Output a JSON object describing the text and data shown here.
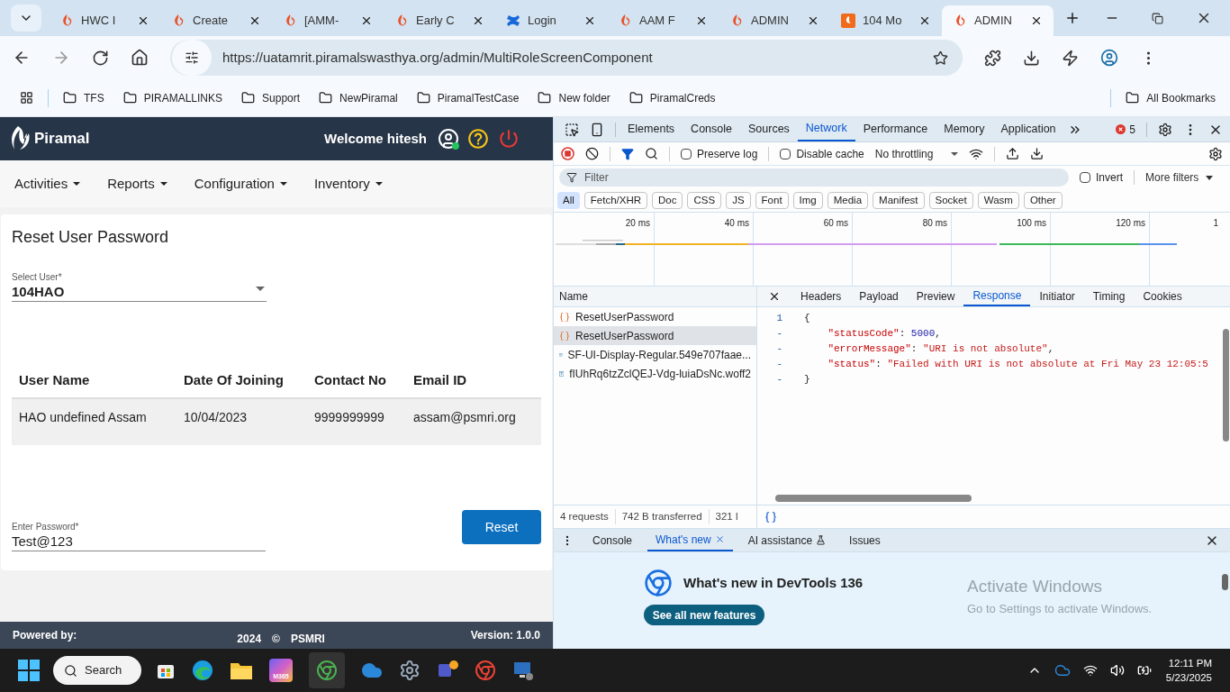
{
  "browser": {
    "tabs": [
      {
        "title": "HWC I",
        "kind": "flame",
        "selected": false
      },
      {
        "title": "Create",
        "kind": "flame",
        "selected": false
      },
      {
        "title": "[AMM-",
        "kind": "flame",
        "selected": false
      },
      {
        "title": "Early C",
        "kind": "flame",
        "selected": false
      },
      {
        "title": "Login",
        "kind": "cross",
        "selected": false
      },
      {
        "title": "AAM F",
        "kind": "flame",
        "selected": false
      },
      {
        "title": "ADMIN",
        "kind": "flame",
        "selected": false
      },
      {
        "title": "104 Mo",
        "kind": "square",
        "selected": false
      },
      {
        "title": "ADMIN",
        "kind": "flame",
        "selected": true
      }
    ],
    "url": "https://uatamrit.piramalswasthya.org/admin/MultiRoleScreenComponent",
    "bookmarks": [
      "TFS",
      "PIRAMALLINKS",
      "Support",
      "NewPiramal",
      "PiramalTestCase",
      "New folder",
      "PiramalCreds"
    ],
    "all_bookmarks": "All Bookmarks"
  },
  "app": {
    "brand": "Piramal",
    "welcome": "Welcome hitesh",
    "user_online": true,
    "menu": [
      "Activities",
      "Reports",
      "Configuration",
      "Inventory"
    ],
    "page_title": "Reset User Password",
    "select_user": {
      "label": "Select User*",
      "value": "104HAO"
    },
    "table": {
      "columns": [
        "User Name",
        "Date Of Joining",
        "Contact No",
        "Email ID"
      ],
      "rows": [
        [
          "HAO undefined Assam",
          "10/04/2023",
          "9999999999",
          "assam@psmri.org"
        ]
      ]
    },
    "password": {
      "label": "Enter Password*",
      "value": "Test@123"
    },
    "reset_button": "Reset",
    "footer": {
      "powered_by": "Powered by:",
      "year": "2024",
      "copyright": "©",
      "org": "PSMRI",
      "version": "Version: 1.0.0"
    }
  },
  "devtools": {
    "panels": [
      {
        "label": "Elements",
        "selected": false
      },
      {
        "label": "Console",
        "selected": false
      },
      {
        "label": "Sources",
        "selected": false
      },
      {
        "label": "Network",
        "selected": true
      },
      {
        "label": "Performance",
        "selected": false
      },
      {
        "label": "Memory",
        "selected": false
      },
      {
        "label": "Application",
        "selected": false
      }
    ],
    "error_count": "5",
    "recording": true,
    "preserve_log": {
      "label": "Preserve log",
      "checked": false
    },
    "disable_cache": {
      "label": "Disable cache",
      "checked": false
    },
    "throttling": "No throttling",
    "filter_placeholder": "Filter",
    "invert": {
      "label": "Invert",
      "checked": false
    },
    "more_filters": "More filters",
    "type_filters": [
      {
        "label": "All",
        "selected": true
      },
      {
        "label": "Fetch/XHR",
        "selected": false
      },
      {
        "label": "Doc",
        "selected": false
      },
      {
        "label": "CSS",
        "selected": false
      },
      {
        "label": "JS",
        "selected": false
      },
      {
        "label": "Font",
        "selected": false
      },
      {
        "label": "Img",
        "selected": false
      },
      {
        "label": "Media",
        "selected": false
      },
      {
        "label": "Manifest",
        "selected": false
      },
      {
        "label": "Socket",
        "selected": false
      },
      {
        "label": "Wasm",
        "selected": false
      },
      {
        "label": "Other",
        "selected": false
      }
    ],
    "timeline_ticks": [
      "20 ms",
      "40 ms",
      "60 ms",
      "80 ms",
      "100 ms",
      "120 ms",
      "1"
    ],
    "name_column": "Name",
    "requests": [
      {
        "name": "ResetUserPassword",
        "kind": "xhr",
        "selected": false
      },
      {
        "name": "ResetUserPassword",
        "kind": "xhr",
        "selected": true
      },
      {
        "name": "SF-UI-Display-Regular.549e707faae...",
        "kind": "font",
        "selected": false
      },
      {
        "name": "fIUhRq6tzZclQEJ-Vdg-luiaDsNc.woff2",
        "kind": "font",
        "selected": false
      }
    ],
    "detail_tabs": [
      {
        "label": "Headers",
        "selected": false
      },
      {
        "label": "Payload",
        "selected": false
      },
      {
        "label": "Preview",
        "selected": false
      },
      {
        "label": "Response",
        "selected": true
      },
      {
        "label": "Initiator",
        "selected": false
      },
      {
        "label": "Timing",
        "selected": false
      },
      {
        "label": "Cookies",
        "selected": false
      }
    ],
    "response_lines": [
      {
        "number": "1",
        "parts": [
          {
            "kind": "punct",
            "text": "{"
          }
        ]
      },
      {
        "number": "-",
        "parts": [
          {
            "kind": "key",
            "text": "    \"statusCode\""
          },
          {
            "kind": "punct",
            "text": ": "
          },
          {
            "kind": "number",
            "text": "5000"
          },
          {
            "kind": "punct",
            "text": ","
          }
        ]
      },
      {
        "number": "-",
        "parts": [
          {
            "kind": "key",
            "text": "    \"errorMessage\""
          },
          {
            "kind": "punct",
            "text": ": "
          },
          {
            "kind": "string",
            "text": "\"URI is not absolute\""
          },
          {
            "kind": "punct",
            "text": ","
          }
        ]
      },
      {
        "number": "-",
        "parts": [
          {
            "kind": "key",
            "text": "    \"status\""
          },
          {
            "kind": "punct",
            "text": ": "
          },
          {
            "kind": "string",
            "text": "\"Failed with URI is not absolute at Fri May 23 12:05:5"
          }
        ]
      },
      {
        "number": "-",
        "parts": [
          {
            "kind": "punct",
            "text": "}"
          }
        ]
      }
    ],
    "summary": [
      "4 requests",
      "742 B transferred",
      "321 l"
    ],
    "drawer_tabs": [
      {
        "label": "Console",
        "selected": false,
        "closable": false,
        "experimental": false
      },
      {
        "label": "What's new",
        "selected": true,
        "closable": true,
        "experimental": false
      },
      {
        "label": "AI assistance",
        "selected": false,
        "closable": false,
        "experimental": true
      },
      {
        "label": "Issues",
        "selected": false,
        "closable": false,
        "experimental": false
      }
    ],
    "whats_new_title": "What's new in DevTools 136",
    "whats_new_button": "See all new features",
    "activation": {
      "title": "Activate Windows",
      "subtitle": "Go to Settings to activate Windows."
    }
  },
  "taskbar": {
    "search": "Search",
    "m365_label": "M365",
    "time": "12:11 PM",
    "date": "5/23/2025"
  }
}
